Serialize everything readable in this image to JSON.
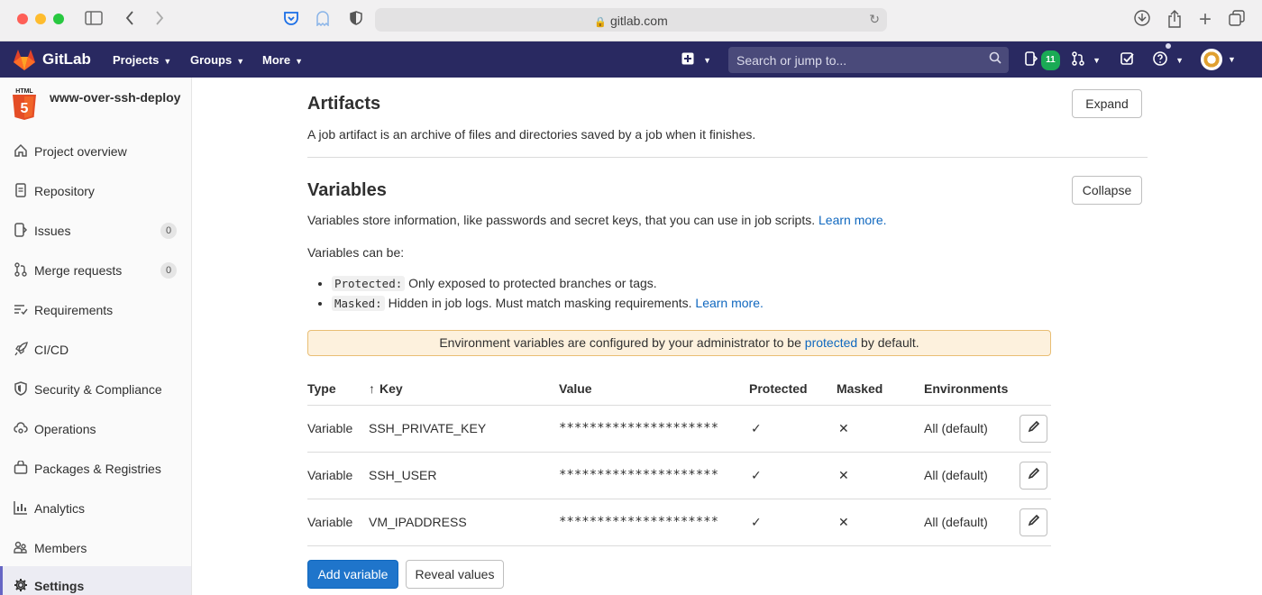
{
  "browser": {
    "url": "gitlab.com"
  },
  "navbar": {
    "brand": "GitLab",
    "menus": [
      "Projects",
      "Groups",
      "More"
    ],
    "search_placeholder": "Search or jump to...",
    "issues_count": "11"
  },
  "sidebar": {
    "project_name": "www-over-ssh-deploy",
    "items": [
      {
        "label": "Project overview",
        "icon": "home-icon"
      },
      {
        "label": "Repository",
        "icon": "doc-icon"
      },
      {
        "label": "Issues",
        "icon": "issues-icon",
        "count": "0"
      },
      {
        "label": "Merge requests",
        "icon": "merge-request-icon",
        "count": "0"
      },
      {
        "label": "Requirements",
        "icon": "requirements-icon"
      },
      {
        "label": "CI/CD",
        "icon": "rocket-icon"
      },
      {
        "label": "Security & Compliance",
        "icon": "shield-icon"
      },
      {
        "label": "Operations",
        "icon": "cloud-gear-icon"
      },
      {
        "label": "Packages & Registries",
        "icon": "package-icon"
      },
      {
        "label": "Analytics",
        "icon": "chart-icon"
      },
      {
        "label": "Members",
        "icon": "users-icon"
      },
      {
        "label": "Settings",
        "icon": "gear-icon"
      }
    ]
  },
  "artifacts": {
    "title": "Artifacts",
    "description": "A job artifact is an archive of files and directories saved by a job when it finishes.",
    "button": "Expand"
  },
  "variables": {
    "title": "Variables",
    "button": "Collapse",
    "description": "Variables store information, like passwords and secret keys, that you can use in job scripts.",
    "learn_more": "Learn more.",
    "can_be": "Variables can be:",
    "protected_code": "Protected:",
    "protected_text": "Only exposed to protected branches or tags.",
    "masked_code": "Masked:",
    "masked_text": "Hidden in job logs. Must match masking requirements.",
    "masked_learn_more": "Learn more.",
    "alert_before": "Environment variables are configured by your administrator to be",
    "alert_link": "protected",
    "alert_after": "by default.",
    "columns": {
      "type": "Type",
      "key": "Key",
      "value": "Value",
      "protected": "Protected",
      "masked": "Masked",
      "environments": "Environments"
    },
    "rows": [
      {
        "type": "Variable",
        "key": "SSH_PRIVATE_KEY",
        "value": "*********************",
        "protected": "✓",
        "masked": "✕",
        "env": "All (default)"
      },
      {
        "type": "Variable",
        "key": "SSH_USER",
        "value": "*********************",
        "protected": "✓",
        "masked": "✕",
        "env": "All (default)"
      },
      {
        "type": "Variable",
        "key": "VM_IPADDRESS",
        "value": "*********************",
        "protected": "✓",
        "masked": "✕",
        "env": "All (default)"
      }
    ],
    "add_button": "Add variable",
    "reveal_button": "Reveal values"
  }
}
